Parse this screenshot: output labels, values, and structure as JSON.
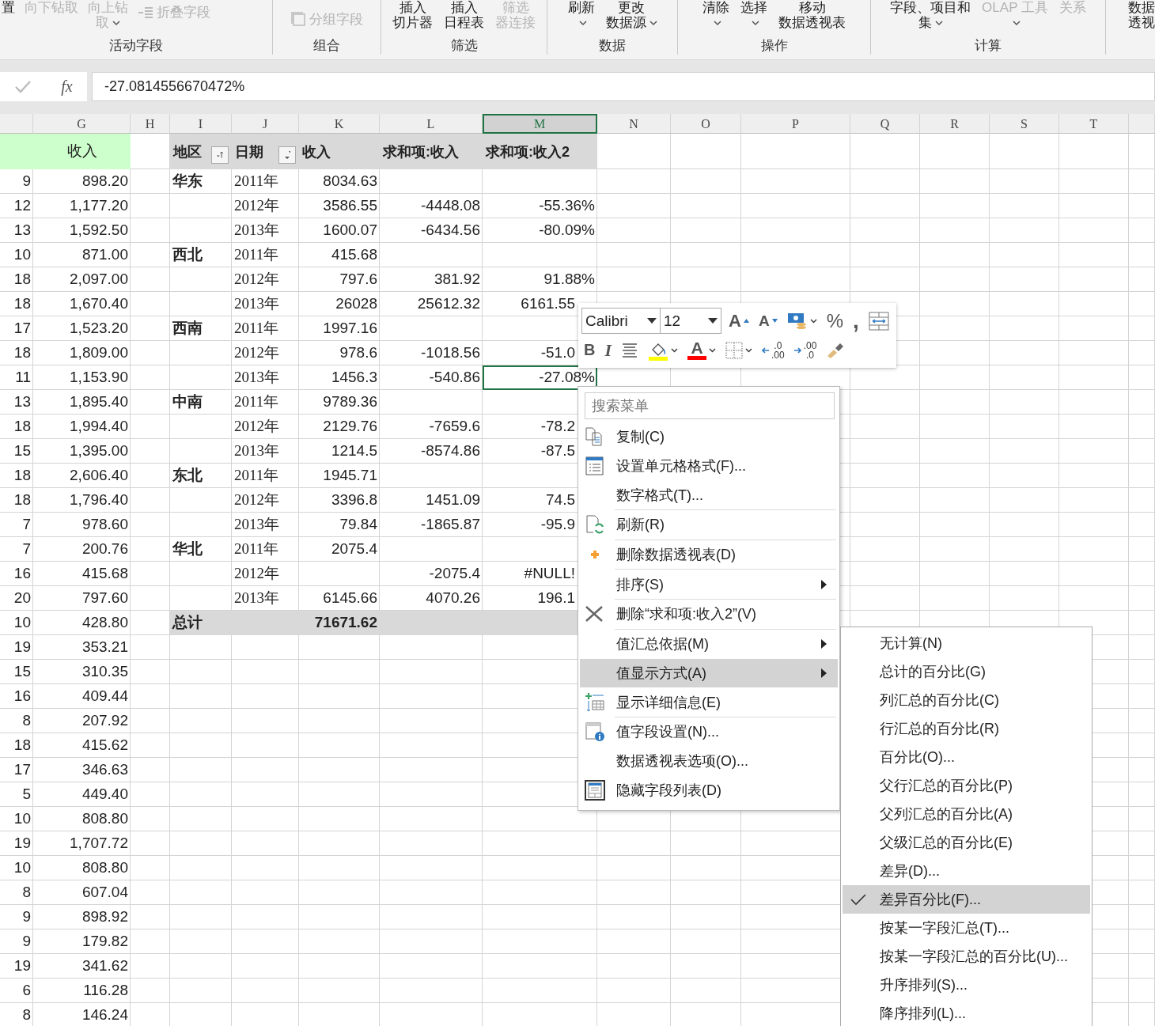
{
  "ribbon": {
    "groups": [
      {
        "label": "活动字段",
        "buttons": [
          {
            "kind": "text",
            "lines": [
              "置"
            ],
            "disabled": false,
            "dropdown": false
          },
          {
            "kind": "text",
            "lines": [
              "向下钻取"
            ],
            "disabled": true,
            "dropdown": false
          },
          {
            "kind": "text",
            "lines": [
              "向上钻",
              "取"
            ],
            "disabled": true,
            "dropdown": true
          },
          {
            "kind": "collapse",
            "lines": [
              "折叠字段"
            ],
            "disabled": true,
            "dropdown": false
          }
        ]
      },
      {
        "label": "组合",
        "buttons": [
          {
            "kind": "group",
            "lines": [
              "分组字段"
            ],
            "disabled": true,
            "dropdown": false
          }
        ]
      },
      {
        "label": "筛选",
        "buttons": [
          {
            "kind": "text",
            "lines": [
              "插入",
              "切片器"
            ],
            "disabled": false,
            "dropdown": false
          },
          {
            "kind": "text",
            "lines": [
              "插入",
              "日程表"
            ],
            "disabled": false,
            "dropdown": false
          },
          {
            "kind": "text",
            "lines": [
              "筛选",
              "器连接"
            ],
            "disabled": true,
            "dropdown": false
          }
        ]
      },
      {
        "label": "数据",
        "buttons": [
          {
            "kind": "text",
            "lines": [
              "刷新"
            ],
            "disabled": false,
            "dropdown": true
          },
          {
            "kind": "text",
            "lines": [
              "更改",
              "数据源"
            ],
            "disabled": false,
            "dropdown": true
          }
        ]
      },
      {
        "label": "操作",
        "buttons": [
          {
            "kind": "text",
            "lines": [
              "清除"
            ],
            "disabled": false,
            "dropdown": true
          },
          {
            "kind": "text",
            "lines": [
              "选择"
            ],
            "disabled": false,
            "dropdown": true
          },
          {
            "kind": "text",
            "lines": [
              "移动",
              "数据透视表"
            ],
            "disabled": false,
            "dropdown": false
          }
        ]
      },
      {
        "label": "计算",
        "buttons": [
          {
            "kind": "text",
            "lines": [
              "字段、项目和",
              "集"
            ],
            "disabled": false,
            "dropdown": true
          },
          {
            "kind": "text",
            "lines": [
              "OLAP 工具"
            ],
            "disabled": true,
            "dropdown": true
          },
          {
            "kind": "text",
            "lines": [
              "关系"
            ],
            "disabled": true,
            "dropdown": false
          }
        ]
      },
      {
        "buttons": [
          {
            "kind": "text",
            "lines": [
              "数据",
              "透视"
            ],
            "disabled": false,
            "dropdown": false
          }
        ]
      }
    ]
  },
  "formula_bar": {
    "fx": "fx",
    "value": "-27.0814556670472%"
  },
  "columns": [
    {
      "letter": "G",
      "selected": false
    },
    {
      "letter": "H",
      "selected": false
    },
    {
      "letter": "I",
      "selected": false
    },
    {
      "letter": "J",
      "selected": false
    },
    {
      "letter": "K",
      "selected": false
    },
    {
      "letter": "L",
      "selected": false
    },
    {
      "letter": "M",
      "selected": true
    },
    {
      "letter": "N",
      "selected": false
    },
    {
      "letter": "O",
      "selected": false
    },
    {
      "letter": "P",
      "selected": false
    },
    {
      "letter": "Q",
      "selected": false
    },
    {
      "letter": "R",
      "selected": false
    },
    {
      "letter": "S",
      "selected": false
    },
    {
      "letter": "T",
      "selected": false
    }
  ],
  "header_row": {
    "g": "收入",
    "i": "地区",
    "j": "日期",
    "k": "收入",
    "l": "求和项:收入",
    "m": "求和项:收入2"
  },
  "rows": [
    {
      "kind": "pivot",
      "selected": false,
      "f": "9",
      "g": "898.20",
      "i": "华东",
      "j": "2011年",
      "k": "8034.63"
    },
    {
      "kind": "pivot",
      "selected": false,
      "f": "12",
      "g": "1,177.20",
      "j": "2012年",
      "k": "3586.55",
      "l": "-4448.08",
      "m": "-55.36%"
    },
    {
      "kind": "pivot",
      "selected": false,
      "f": "13",
      "g": "1,592.50",
      "j": "2013年",
      "k": "1600.07",
      "l": "-6434.56",
      "m": "-80.09%"
    },
    {
      "kind": "pivot",
      "selected": false,
      "f": "10",
      "g": "871.00",
      "i": "西北",
      "j": "2011年",
      "k": "415.68"
    },
    {
      "kind": "pivot",
      "selected": false,
      "f": "18",
      "g": "2,097.00",
      "j": "2012年",
      "k": "797.6",
      "l": "381.92",
      "m": "91.88%"
    },
    {
      "kind": "pivot",
      "selected": false,
      "f": "18",
      "g": "1,670.40",
      "j": "2013年",
      "k": "26028",
      "l": "25612.32",
      "m": "6161.55"
    },
    {
      "kind": "pivot",
      "selected": false,
      "f": "17",
      "g": "1,523.20",
      "i": "西南",
      "j": "2011年",
      "k": "1997.16"
    },
    {
      "kind": "pivot",
      "selected": false,
      "f": "18",
      "g": "1,809.00",
      "j": "2012年",
      "k": "978.6",
      "l": "-1018.56",
      "m": "-51.0"
    },
    {
      "kind": "pivot",
      "selected": true,
      "f": "11",
      "g": "1,153.90",
      "j": "2013年",
      "k": "1456.3",
      "l": "-540.86",
      "m": "-27.08%"
    },
    {
      "kind": "pivot",
      "selected": false,
      "f": "13",
      "g": "1,895.40",
      "i": "中南",
      "j": "2011年",
      "k": "9789.36"
    },
    {
      "kind": "pivot",
      "selected": false,
      "f": "18",
      "g": "1,994.40",
      "j": "2012年",
      "k": "2129.76",
      "l": "-7659.6",
      "m": "-78.2"
    },
    {
      "kind": "pivot",
      "selected": false,
      "f": "15",
      "g": "1,395.00",
      "j": "2013年",
      "k": "1214.5",
      "l": "-8574.86",
      "m": "-87.5"
    },
    {
      "kind": "pivot",
      "selected": false,
      "f": "18",
      "g": "2,606.40",
      "i": "东北",
      "j": "2011年",
      "k": "1945.71"
    },
    {
      "kind": "pivot",
      "selected": false,
      "f": "18",
      "g": "1,796.40",
      "j": "2012年",
      "k": "3396.8",
      "l": "1451.09",
      "m": "74.5"
    },
    {
      "kind": "pivot",
      "selected": false,
      "f": "7",
      "g": "978.60",
      "j": "2013年",
      "k": "79.84",
      "l": "-1865.87",
      "m": "-95.9"
    },
    {
      "kind": "pivot",
      "selected": false,
      "f": "7",
      "g": "200.76",
      "i": "华北",
      "j": "2011年",
      "k": "2075.4"
    },
    {
      "kind": "pivot",
      "selected": false,
      "f": "16",
      "g": "415.68",
      "j": "2012年",
      "l": "-2075.4",
      "m": "#NULL!"
    },
    {
      "kind": "pivot",
      "selected": false,
      "f": "20",
      "g": "797.60",
      "j": "2013年",
      "k": "6145.66",
      "l": "4070.26",
      "m": "196.1"
    },
    {
      "kind": "total",
      "selected": false,
      "f": "10",
      "g": "428.80",
      "i": "总计",
      "k": "71671.62"
    },
    {
      "kind": "plain",
      "selected": false,
      "f": "19",
      "g": "353.21"
    },
    {
      "kind": "plain",
      "selected": false,
      "f": "15",
      "g": "310.35"
    },
    {
      "kind": "plain",
      "selected": false,
      "f": "16",
      "g": "409.44"
    },
    {
      "kind": "plain",
      "selected": false,
      "f": "8",
      "g": "207.92"
    },
    {
      "kind": "plain",
      "selected": false,
      "f": "18",
      "g": "415.62"
    },
    {
      "kind": "plain",
      "selected": false,
      "f": "17",
      "g": "346.63"
    },
    {
      "kind": "plain",
      "selected": false,
      "f": "5",
      "g": "449.40"
    },
    {
      "kind": "plain",
      "selected": false,
      "f": "10",
      "g": "808.80"
    },
    {
      "kind": "plain",
      "selected": false,
      "f": "19",
      "g": "1,707.72"
    },
    {
      "kind": "plain",
      "selected": false,
      "f": "10",
      "g": "808.80"
    },
    {
      "kind": "plain",
      "selected": false,
      "f": "8",
      "g": "607.04"
    },
    {
      "kind": "plain",
      "selected": false,
      "f": "9",
      "g": "898.92"
    },
    {
      "kind": "plain",
      "selected": false,
      "f": "9",
      "g": "179.82"
    },
    {
      "kind": "plain",
      "selected": false,
      "f": "19",
      "g": "341.62"
    },
    {
      "kind": "plain",
      "selected": false,
      "f": "6",
      "g": "116.28"
    },
    {
      "kind": "plain",
      "selected": false,
      "f": "8",
      "g": "146.24"
    }
  ],
  "mini_toolbar": {
    "font": "Calibri",
    "size": "12",
    "row1": [
      {
        "kind": "grow",
        "label": "A"
      },
      {
        "kind": "shrink",
        "label": "A"
      },
      {
        "kind": "accounting"
      },
      {
        "kind": "percent",
        "label": "%"
      },
      {
        "kind": "comma",
        "label": ","
      },
      {
        "kind": "wrap"
      }
    ],
    "row2": [
      {
        "kind": "bold",
        "label": "B"
      },
      {
        "kind": "italic",
        "label": "I"
      },
      {
        "kind": "center"
      },
      {
        "kind": "fill",
        "color": "#ffff00"
      },
      {
        "kind": "fontcolor",
        "label": "A",
        "color": "#ff0000"
      },
      {
        "kind": "borders"
      },
      {
        "kind": "incdec",
        "lines": [
          ".0",
          ".00"
        ]
      },
      {
        "kind": "decdec",
        "lines": [
          ".00",
          ".0"
        ]
      },
      {
        "kind": "painter"
      }
    ]
  },
  "context_menu": {
    "search": {
      "placeholder": "搜索菜单"
    },
    "items": [
      {
        "kind": "item",
        "label": "复制(C)",
        "submenu": false,
        "selected": false
      },
      {
        "kind": "item",
        "label": "设置单元格格式(F)...",
        "submenu": false,
        "selected": false
      },
      {
        "kind": "item",
        "label": "数字格式(T)...",
        "submenu": false,
        "selected": false
      },
      {
        "kind": "separator"
      },
      {
        "kind": "item",
        "label": "刷新(R)",
        "submenu": false,
        "selected": false
      },
      {
        "kind": "separator"
      },
      {
        "kind": "item",
        "label": "删除数据透视表(D)",
        "submenu": false,
        "selected": false
      },
      {
        "kind": "separator"
      },
      {
        "kind": "item",
        "label": "排序(S)",
        "submenu": true,
        "selected": false
      },
      {
        "kind": "separator"
      },
      {
        "kind": "item",
        "label": "删除“求和项:收入2”(V)",
        "submenu": false,
        "selected": false
      },
      {
        "kind": "separator"
      },
      {
        "kind": "item",
        "label": "值汇总依据(M)",
        "submenu": true,
        "selected": false
      },
      {
        "kind": "item",
        "label": "值显示方式(A)",
        "submenu": true,
        "selected": true
      },
      {
        "kind": "item",
        "label": "显示详细信息(E)",
        "submenu": false,
        "selected": false
      },
      {
        "kind": "separator"
      },
      {
        "kind": "item",
        "label": "值字段设置(N)...",
        "submenu": false,
        "selected": false
      },
      {
        "kind": "item",
        "label": "数据透视表选项(O)...",
        "submenu": false,
        "selected": false
      },
      {
        "kind": "item",
        "label": "隐藏字段列表(D)",
        "submenu": false,
        "selected": false
      }
    ]
  },
  "submenu": {
    "items": [
      {
        "label": "无计算(N)",
        "checked": false,
        "selected": false
      },
      {
        "label": "总计的百分比(G)",
        "checked": false,
        "selected": false
      },
      {
        "label": "列汇总的百分比(C)",
        "checked": false,
        "selected": false
      },
      {
        "label": "行汇总的百分比(R)",
        "checked": false,
        "selected": false
      },
      {
        "label": "百分比(O)...",
        "checked": false,
        "selected": false
      },
      {
        "label": "父行汇总的百分比(P)",
        "checked": false,
        "selected": false
      },
      {
        "label": "父列汇总的百分比(A)",
        "checked": false,
        "selected": false
      },
      {
        "label": "父级汇总的百分比(E)",
        "checked": false,
        "selected": false
      },
      {
        "label": "差异(D)...",
        "checked": false,
        "selected": false
      },
      {
        "label": "差异百分比(F)...",
        "checked": true,
        "selected": true
      },
      {
        "label": "按某一字段汇总(T)...",
        "checked": false,
        "selected": false
      },
      {
        "label": "按某一字段汇总的百分比(U)...",
        "checked": false,
        "selected": false
      },
      {
        "label": "升序排列(S)...",
        "checked": false,
        "selected": false
      },
      {
        "label": "降序排列(L)...",
        "checked": false,
        "selected": false
      }
    ]
  }
}
